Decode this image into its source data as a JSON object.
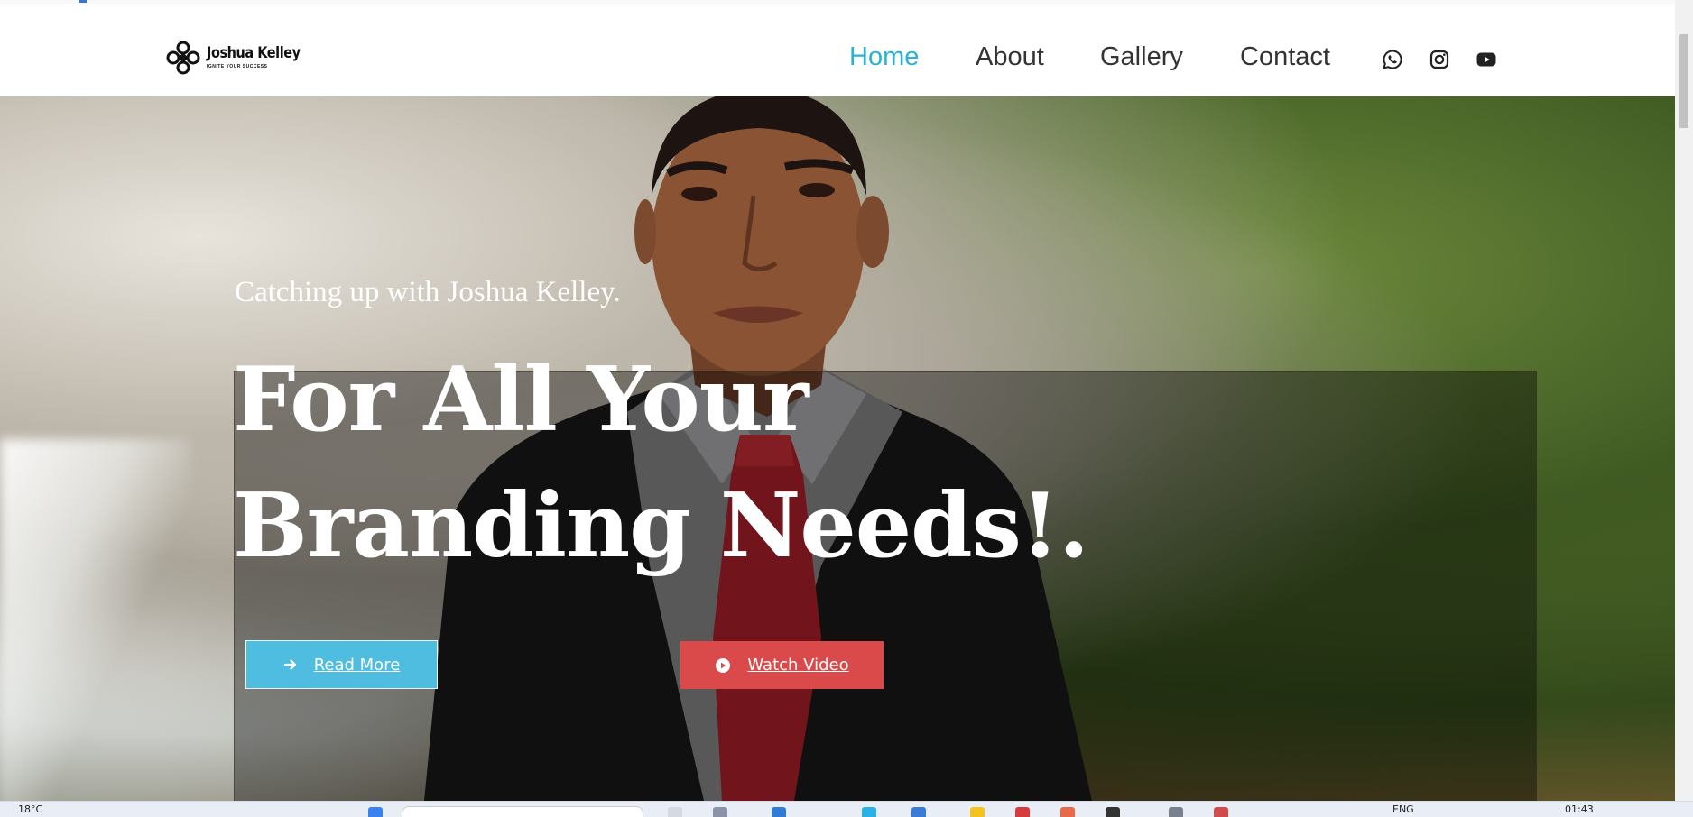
{
  "header": {
    "logo": {
      "name": "Joshua Kelley",
      "tagline": "IGNITE YOUR SUCCESS"
    },
    "nav": [
      {
        "label": "Home",
        "active": true
      },
      {
        "label": "About",
        "active": false
      },
      {
        "label": "Gallery",
        "active": false
      },
      {
        "label": "Contact",
        "active": false
      }
    ],
    "social": [
      "whatsapp-icon",
      "instagram-icon",
      "youtube-icon"
    ]
  },
  "hero": {
    "kicker": "Catching up with Joshua Kelley.",
    "headline_line1": "For All Your",
    "headline_line2": "Branding Needs!.",
    "buttons": {
      "read_more": "Read More",
      "watch_video": "Watch Video"
    }
  },
  "taskbar": {
    "weather": "18°C",
    "language": "ENG",
    "time": "01:43"
  },
  "colors": {
    "accent": "#2bb0d6",
    "read_more_bg": "#4fbde0",
    "watch_video_bg": "#db4a4a",
    "nav_text": "#333333"
  }
}
